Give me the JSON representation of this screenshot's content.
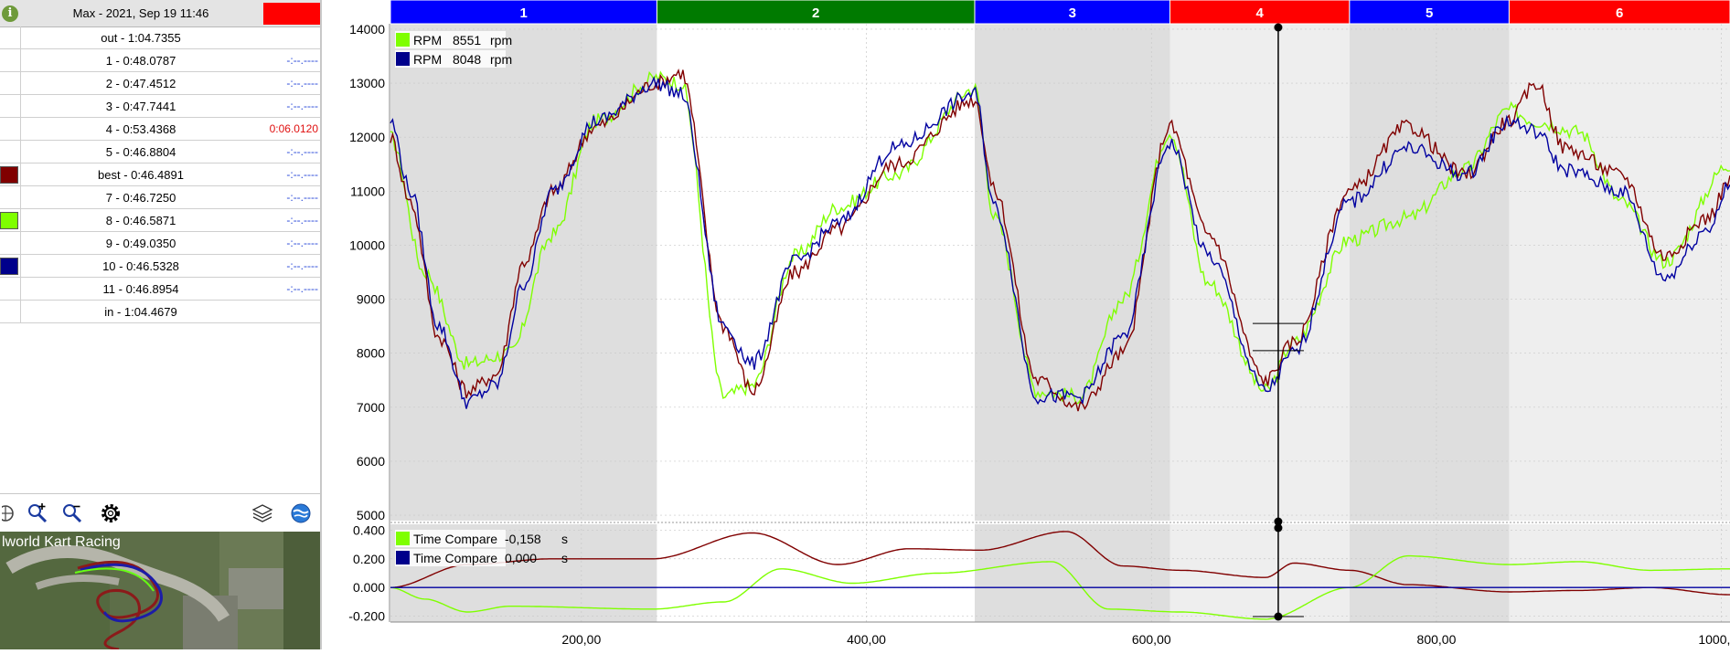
{
  "session": {
    "title": "Max - 2021, Sep 19 11:46",
    "flag_color": "#ff0000"
  },
  "laps": [
    {
      "label": "out - 1:04.7355",
      "diff": "",
      "swatch": null
    },
    {
      "label": "1 - 0:48.0787",
      "diff": "-:--.----",
      "swatch": null
    },
    {
      "label": "2 - 0:47.4512",
      "diff": "-:--.----",
      "swatch": null
    },
    {
      "label": "3 - 0:47.7441",
      "diff": "-:--.----",
      "swatch": null
    },
    {
      "label": "4 - 0:53.4368",
      "diff": "0:06.0120",
      "diff_red": true,
      "swatch": null
    },
    {
      "label": "5 - 0:46.8804",
      "diff": "-:--.----",
      "swatch": null
    },
    {
      "label": "best - 0:46.4891",
      "diff": "-:--.----",
      "swatch": "#800000"
    },
    {
      "label": "7 - 0:46.7250",
      "diff": "-:--.----",
      "swatch": null
    },
    {
      "label": "8 - 0:46.5871",
      "diff": "-:--.----",
      "swatch": "#7fff00"
    },
    {
      "label": "9 - 0:49.0350",
      "diff": "-:--.----",
      "swatch": null
    },
    {
      "label": "10 - 0:46.5328",
      "diff": "-:--.----",
      "swatch": "#00008b"
    },
    {
      "label": "11 - 0:46.8954",
      "diff": "-:--.----",
      "swatch": null
    },
    {
      "label": "in - 1:04.4679",
      "diff": "",
      "swatch": null
    }
  ],
  "map": {
    "label": "lworld Kart Racing"
  },
  "toolbar": {
    "icons": [
      "compass-icon",
      "zoom-in-icon",
      "zoom-out-icon",
      "gear-icon",
      "layers-icon",
      "globe-icon"
    ]
  },
  "sectors": [
    {
      "label": "1",
      "color": "#0000ff",
      "start": 66,
      "end": 253
    },
    {
      "label": "2",
      "color": "#007a00",
      "start": 253,
      "end": 476
    },
    {
      "label": "3",
      "color": "#0000ff",
      "start": 476,
      "end": 613
    },
    {
      "label": "4",
      "color": "#ff0000",
      "start": 613,
      "end": 739
    },
    {
      "label": "5",
      "color": "#0000ff",
      "start": 739,
      "end": 851
    },
    {
      "label": "6",
      "color": "#ff0000",
      "start": 851,
      "end": 1006
    }
  ],
  "cursor_x": 689,
  "chart_data": [
    {
      "type": "line",
      "title": "",
      "legend": [
        {
          "label": "RPM",
          "value": "8551",
          "unit": "rpm",
          "color": "#7fff00"
        },
        {
          "label": "RPM",
          "value": "8048",
          "unit": "rpm",
          "color": "#00008b"
        }
      ],
      "xlim": [
        66,
        1006
      ],
      "ylim": [
        4900,
        14100
      ],
      "yticks": [
        5000,
        6000,
        7000,
        8000,
        9000,
        10000,
        11000,
        12000,
        13000,
        14000
      ],
      "ytick_labels": [
        "5000",
        "6000",
        "7000",
        "8000",
        "9000",
        "10000",
        "11000",
        "12000",
        "13000",
        "14000"
      ],
      "series": [
        {
          "color": "#7fff00",
          "x": [
            66,
            90,
            120,
            150,
            180,
            210,
            253,
            270,
            300,
            320,
            350,
            380,
            420,
            476,
            490,
            520,
            550,
            580,
            613,
            640,
            680,
            700,
            739,
            780,
            820,
            851,
            870,
            900,
            930,
            960,
            1006
          ],
          "y": [
            12000,
            9500,
            7800,
            8000,
            10200,
            12300,
            13100,
            13000,
            7200,
            7400,
            9800,
            10700,
            11300,
            12900,
            10500,
            7300,
            7200,
            9000,
            12100,
            9300,
            7300,
            8200,
            10100,
            10500,
            11400,
            12500,
            12300,
            12100,
            10800,
            9700,
            11500
          ]
        },
        {
          "color": "#800000",
          "x": [
            66,
            80,
            100,
            120,
            140,
            160,
            180,
            210,
            253,
            270,
            300,
            320,
            350,
            380,
            420,
            476,
            490,
            520,
            550,
            580,
            613,
            640,
            680,
            700,
            739,
            780,
            820,
            851,
            870,
            890,
            930,
            960,
            990,
            1006
          ],
          "y": [
            12000,
            10800,
            8300,
            7300,
            7600,
            9700,
            11000,
            12200,
            13000,
            13200,
            8500,
            7300,
            9500,
            10300,
            11500,
            12700,
            11000,
            7500,
            7000,
            8000,
            12200,
            10200,
            7500,
            8200,
            11000,
            12200,
            11300,
            12300,
            13000,
            11800,
            11300,
            9800,
            10500,
            11200
          ]
        },
        {
          "color": "#0000a0",
          "x": [
            66,
            80,
            100,
            120,
            140,
            160,
            180,
            210,
            253,
            270,
            300,
            320,
            350,
            380,
            420,
            476,
            490,
            520,
            550,
            580,
            613,
            640,
            680,
            700,
            739,
            780,
            820,
            851,
            870,
            890,
            930,
            960,
            990,
            1006
          ],
          "y": [
            12300,
            11000,
            8500,
            7100,
            7400,
            9300,
            11000,
            12300,
            13000,
            12800,
            8500,
            7800,
            9700,
            10400,
            11800,
            12800,
            10700,
            7200,
            7200,
            8300,
            11900,
            9800,
            7300,
            8000,
            10800,
            11800,
            11300,
            12300,
            12100,
            11400,
            11000,
            9400,
            10300,
            11100
          ]
        }
      ]
    },
    {
      "type": "line",
      "title": "",
      "legend": [
        {
          "label": "Time Compare",
          "value": "-0,158",
          "unit": "s",
          "color": "#7fff00"
        },
        {
          "label": "Time Compare",
          "value": "0,000",
          "unit": "s",
          "color": "#00008b"
        }
      ],
      "xlim": [
        66,
        1006
      ],
      "ylim": [
        -0.24,
        0.44
      ],
      "yticks": [
        -0.2,
        0,
        0.2,
        0.4
      ],
      "ytick_labels": [
        "-0.200",
        "0.000",
        "0.200",
        "0.400"
      ],
      "xticks": [
        200,
        400,
        600,
        800,
        1000
      ],
      "xtick_labels": [
        "200,00",
        "400,00",
        "600,00",
        "800,00",
        "1000,00"
      ],
      "series": [
        {
          "color": "#800000",
          "x": [
            66,
            120,
            180,
            250,
            320,
            380,
            430,
            480,
            540,
            580,
            620,
            680,
            700,
            739,
            780,
            851,
            900,
            950,
            1006
          ],
          "y": [
            0,
            0.16,
            0.2,
            0.2,
            0.38,
            0.16,
            0.27,
            0.26,
            0.39,
            0.15,
            0.12,
            0.07,
            0.17,
            0.12,
            0.02,
            -0.03,
            -0.02,
            0.0,
            -0.05
          ]
        },
        {
          "color": "#7fff00",
          "x": [
            66,
            90,
            120,
            150,
            250,
            300,
            340,
            390,
            450,
            530,
            570,
            620,
            680,
            739,
            780,
            851,
            900,
            950,
            1006
          ],
          "y": [
            0,
            -0.08,
            -0.17,
            -0.13,
            -0.15,
            -0.1,
            0.13,
            0.03,
            0.1,
            0.18,
            -0.15,
            -0.17,
            -0.22,
            0.0,
            0.22,
            0.16,
            0.18,
            0.12,
            0.13
          ]
        },
        {
          "color": "#0000a0",
          "x": [
            66,
            1006
          ],
          "y": [
            0,
            0
          ]
        }
      ]
    }
  ]
}
